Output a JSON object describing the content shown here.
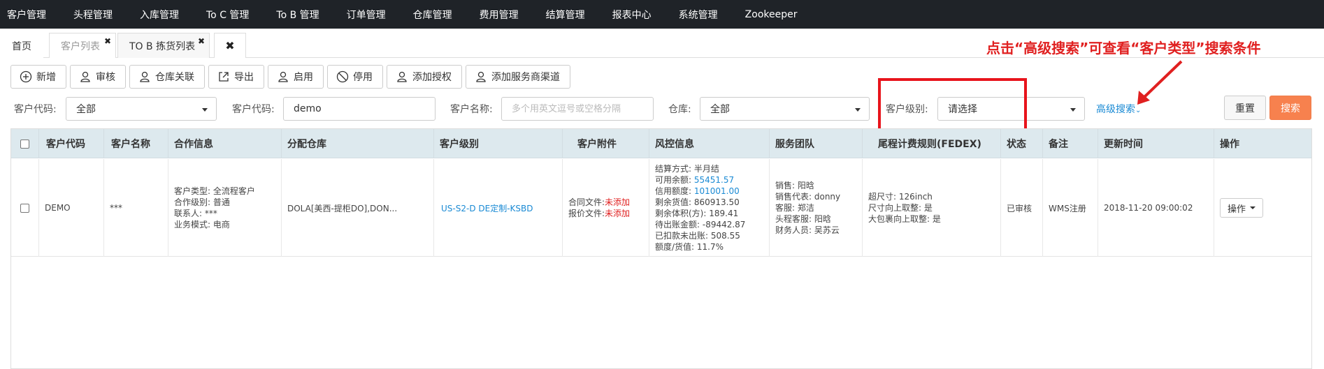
{
  "nav": {
    "items": [
      "客户管理",
      "头程管理",
      "入库管理",
      "To C 管理",
      "To B 管理",
      "订单管理",
      "仓库管理",
      "费用管理",
      "结算管理",
      "报表中心",
      "系统管理",
      "Zookeeper"
    ]
  },
  "tabs": [
    {
      "label": "首页",
      "closable": false,
      "active": false
    },
    {
      "label": "客户列表",
      "closable": true,
      "active": true
    },
    {
      "label": "TO B 拣货列表",
      "closable": true,
      "active": false
    }
  ],
  "annotation": {
    "text": "点击“高级搜索”可查看“客户类型”搜索条件",
    "color": "#e02020"
  },
  "toolbar": {
    "buttons": [
      {
        "label": "新增",
        "icon": "plus-circle-icon"
      },
      {
        "label": "审核",
        "icon": "user-icon"
      },
      {
        "label": "仓库关联",
        "icon": "user-icon"
      },
      {
        "label": "导出",
        "icon": "export-icon"
      },
      {
        "label": "启用",
        "icon": "user-icon"
      },
      {
        "label": "停用",
        "icon": "ban-icon"
      },
      {
        "label": "添加授权",
        "icon": "user-icon"
      },
      {
        "label": "添加服务商渠道",
        "icon": "user-icon"
      }
    ]
  },
  "filters": {
    "code_select_label": "客户代码:",
    "code_select_value": "全部",
    "code_input_label": "客户代码:",
    "code_input_value": "demo",
    "name_label": "客户名称:",
    "name_placeholder": "多个用英文逗号或空格分隔",
    "warehouse_label": "仓库:",
    "warehouse_value": "全部",
    "level_label": "客户级别:",
    "level_value": "请选择",
    "advanced_search": "高级搜索",
    "reset": "重置",
    "search": "搜索",
    "accent_color": "#f7814e"
  },
  "table": {
    "headers": [
      "客户代码",
      "客户名称",
      "合作信息",
      "分配仓库",
      "客户级别",
      "客户附件",
      "风控信息",
      "服务团队",
      "尾程计费规则(FEDEX)",
      "状态",
      "备注",
      "更新时间",
      "操作"
    ],
    "rows": [
      {
        "code": "DEMO",
        "name": "***",
        "coop": [
          "客户类型: 全流程客户",
          "合作级别: 普通",
          "联系人: ***",
          "业务模式: 电商"
        ],
        "warehouse": "DOLA[美西-提柜DO],DON...",
        "level": "US-S2-D DE定制-KSBD",
        "attachments": [
          {
            "label": "合同文件:",
            "value": "未添加"
          },
          {
            "label": "报价文件:",
            "value": "未添加"
          }
        ],
        "risk": {
          "settlement": "结算方式: 半月结",
          "balance_label": "可用余额: ",
          "balance": "55451.57",
          "credit_label": "信用额度: ",
          "credit": "101001.00",
          "goods_value": "剩余货值: 860913.50",
          "volume": "剩余体积(方): 189.41",
          "pending": "待出账金额: -89442.87",
          "deducted": "已扣款未出账: 508.55",
          "ratio": "额度/货值: 11.7%"
        },
        "team": [
          "销售: 阳晗",
          "销售代表: donny",
          "客服: 郑洁",
          "头程客服: 阳晗",
          "财务人员: 吴苏云"
        ],
        "fedex": [
          "超尺寸: 126inch",
          "尺寸向上取整: 是",
          "大包裹向上取整: 是"
        ],
        "status": "已审核",
        "remark": "WMS注册",
        "updated": "2018-11-20 09:00:02",
        "op": "操作"
      }
    ]
  }
}
